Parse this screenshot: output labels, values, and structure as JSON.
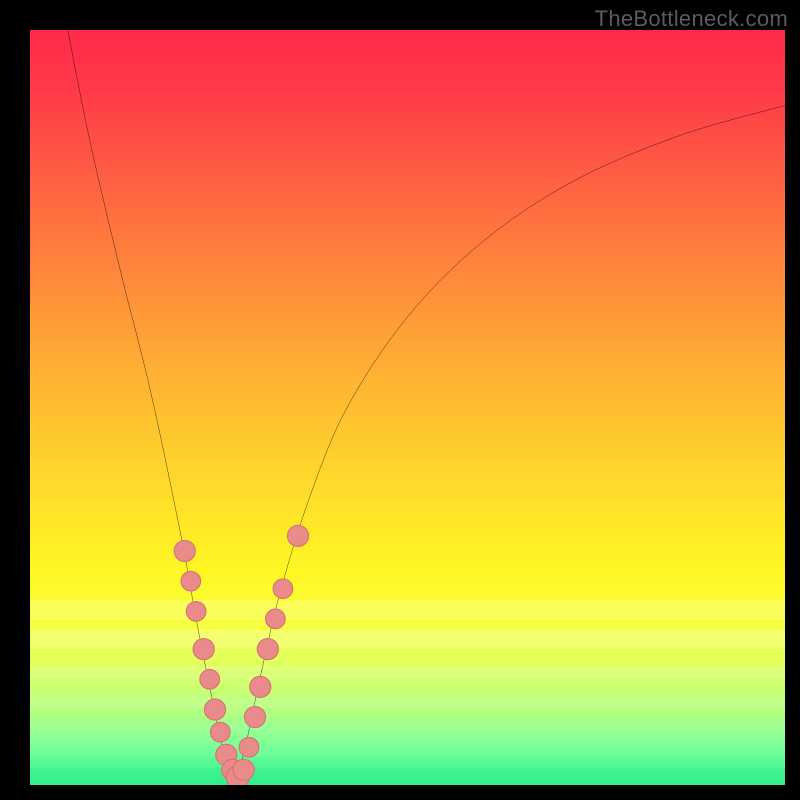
{
  "watermark": {
    "text": "TheBottleneck.com"
  },
  "colors": {
    "frame": "#000000",
    "curve": "#000000",
    "marker_fill": "#e98b8b",
    "marker_stroke": "#d87272",
    "gradient_stops": [
      "#ff2a4a",
      "#ff3a48",
      "#ff5a44",
      "#ff7a3e",
      "#ff9a38",
      "#ffb832",
      "#ffd42c",
      "#ffe928",
      "#fff824",
      "#f7ff3a",
      "#e0ff5e",
      "#b8ff80",
      "#7bff9a",
      "#25f08a"
    ]
  },
  "chart_data": {
    "type": "line",
    "title": "",
    "xlabel": "",
    "ylabel": "",
    "xlim": [
      0,
      100
    ],
    "ylim": [
      0,
      100
    ],
    "grid": false,
    "legend": false,
    "series": [
      {
        "name": "left-branch",
        "x": [
          5,
          8,
          12,
          16,
          20,
          22,
          24,
          25.5,
          27
        ],
        "y": [
          100,
          85,
          68,
          52,
          33,
          22,
          12,
          5,
          0
        ]
      },
      {
        "name": "right-branch",
        "x": [
          27,
          28.5,
          30,
          33,
          37,
          42,
          50,
          60,
          72,
          86,
          100
        ],
        "y": [
          0,
          5,
          12,
          25,
          38,
          50,
          62,
          72,
          80,
          86,
          90
        ]
      }
    ],
    "markers": [
      {
        "x": 20.5,
        "y": 31,
        "r": 1.4
      },
      {
        "x": 21.3,
        "y": 27,
        "r": 1.3
      },
      {
        "x": 22.0,
        "y": 23,
        "r": 1.3
      },
      {
        "x": 23.0,
        "y": 18,
        "r": 1.4
      },
      {
        "x": 23.8,
        "y": 14,
        "r": 1.3
      },
      {
        "x": 24.5,
        "y": 10,
        "r": 1.4
      },
      {
        "x": 25.2,
        "y": 7,
        "r": 1.3
      },
      {
        "x": 26.0,
        "y": 4,
        "r": 1.4
      },
      {
        "x": 26.8,
        "y": 2,
        "r": 1.4
      },
      {
        "x": 27.5,
        "y": 1,
        "r": 1.5
      },
      {
        "x": 28.3,
        "y": 2,
        "r": 1.4
      },
      {
        "x": 29.0,
        "y": 5,
        "r": 1.3
      },
      {
        "x": 29.8,
        "y": 9,
        "r": 1.4
      },
      {
        "x": 30.5,
        "y": 13,
        "r": 1.4
      },
      {
        "x": 31.5,
        "y": 18,
        "r": 1.4
      },
      {
        "x": 32.5,
        "y": 22,
        "r": 1.3
      },
      {
        "x": 33.5,
        "y": 26,
        "r": 1.3
      },
      {
        "x": 35.5,
        "y": 33,
        "r": 1.4
      }
    ]
  }
}
